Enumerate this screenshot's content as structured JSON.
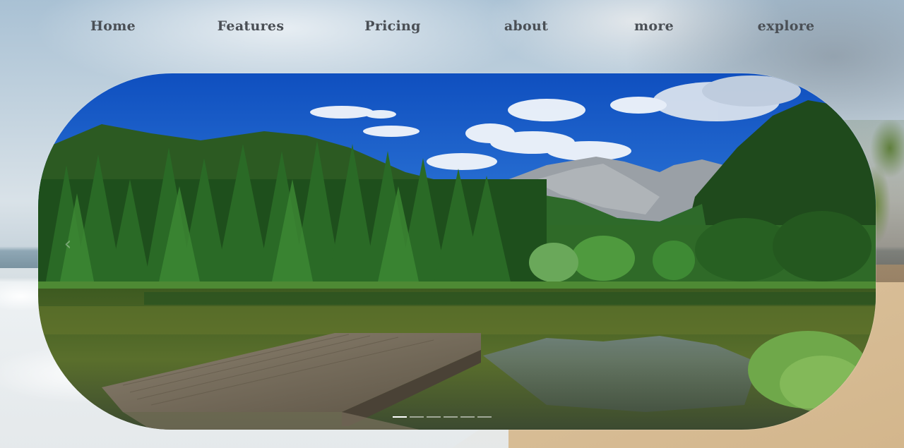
{
  "nav": {
    "items": [
      {
        "label": "Home"
      },
      {
        "label": "Features"
      },
      {
        "label": "Pricing"
      },
      {
        "label": "about"
      },
      {
        "label": "more"
      },
      {
        "label": "explore"
      }
    ]
  },
  "hero": {
    "slide_count": 6,
    "active_slide": 1,
    "prev_icon": "chevron-left-icon",
    "image": "mountain-lake-with-wooden-dock"
  },
  "colors": {
    "nav_text": "#4a4f55",
    "sky": "#1f5fc8",
    "forest": "#2f6a2a",
    "water": "#4f6a2a"
  }
}
